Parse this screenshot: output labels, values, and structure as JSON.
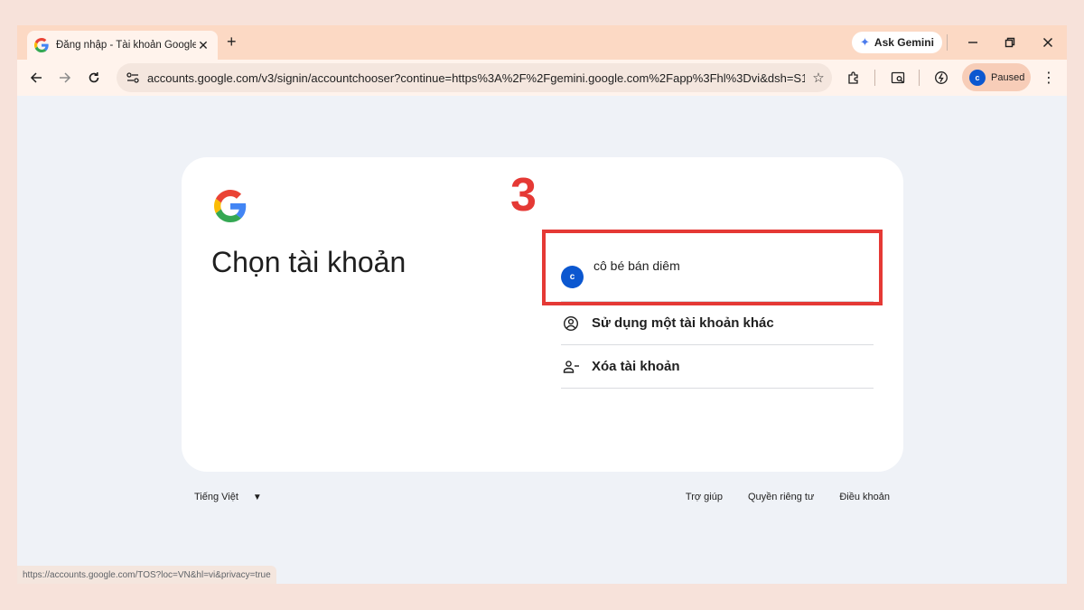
{
  "browser": {
    "tab_title": "Đăng nhập - Tài khoản Google",
    "tab_close": "✕",
    "new_tab": "+",
    "ask_gemini": "Ask Gemini",
    "url": "accounts.google.com/v3/signin/accountchooser?continue=https%3A%2F%2Fgemini.google.com%2Fapp%3Fhl%3Dvi&dsh=S1...",
    "profile_initial": "c",
    "profile_status": "Paused",
    "status_url": "https://accounts.google.com/TOS?loc=VN&hl=vi&privacy=true"
  },
  "page": {
    "heading": "Chọn tài khoản",
    "step_marker": "3",
    "accounts": [
      {
        "initial": "c",
        "name": "cô bé bán diêm"
      }
    ],
    "use_another": "Sử dụng một tài khoản khác",
    "remove_account": "Xóa tài khoản"
  },
  "footer": {
    "language": "Tiếng Việt",
    "help": "Trợ giúp",
    "privacy": "Quyền riêng tư",
    "terms": "Điều khoản"
  },
  "colors": {
    "accent": "#0b57d0",
    "highlight": "#e53935",
    "tabstrip": "#fcd9c4"
  }
}
